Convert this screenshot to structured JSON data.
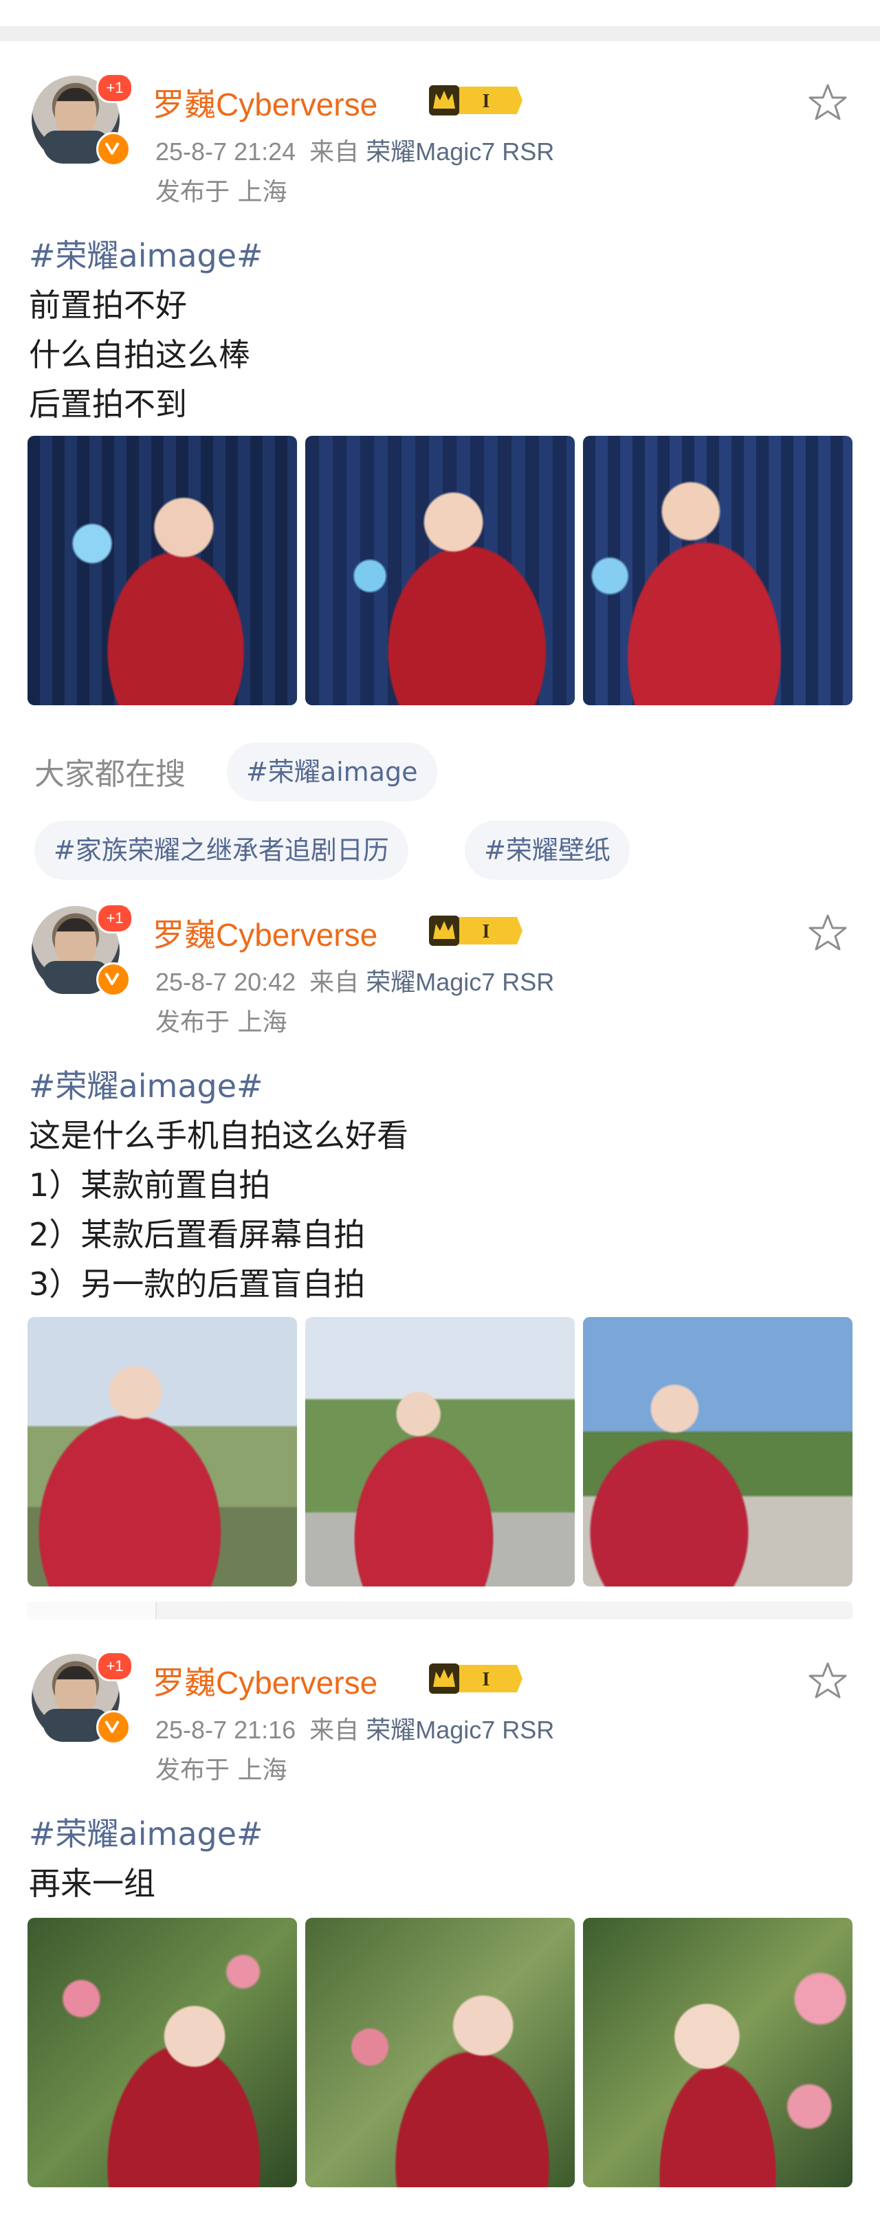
{
  "posts": [
    {
      "username": "罗巍Cyberverse",
      "plus_badge": "+1",
      "vip_level": "I",
      "date": "25-8-7 21:24",
      "from_label": "来自",
      "device": "荣耀Magic7 RSR",
      "location": "发布于 上海",
      "hashtag": "#荣耀aimage#",
      "lines": [
        "前置拍不好",
        "什么自拍这么棒",
        "后置拍不到"
      ]
    },
    {
      "username": "罗巍Cyberverse",
      "plus_badge": "+1",
      "vip_level": "I",
      "date": "25-8-7 20:42",
      "from_label": "来自",
      "device": "荣耀Magic7 RSR",
      "location": "发布于 上海",
      "hashtag": "#荣耀aimage#",
      "lines": [
        "这是什么手机自拍这么好看",
        "1）某款前置自拍",
        "2）某款后置看屏幕自拍",
        "3）另一款的后置盲自拍"
      ]
    },
    {
      "username": "罗巍Cyberverse",
      "plus_badge": "+1",
      "vip_level": "I",
      "date": "25-8-7 21:16",
      "from_label": "来自",
      "device": "荣耀Magic7 RSR",
      "location": "发布于 上海",
      "hashtag": "#荣耀aimage#",
      "lines": [
        "再来一组"
      ]
    }
  ],
  "search": {
    "label": "大家都在搜",
    "chips": [
      "#荣耀aimage",
      "#家族荣耀之继承者追剧日历",
      "#荣耀壁纸"
    ]
  },
  "colors": {
    "username": "#ed6b1a",
    "hashtag": "#556a92",
    "meta": "#8a8a8a",
    "chip_bg": "#f3f5f8"
  },
  "icons": [
    "star-icon",
    "verified-icon",
    "vip-crown-icon"
  ]
}
